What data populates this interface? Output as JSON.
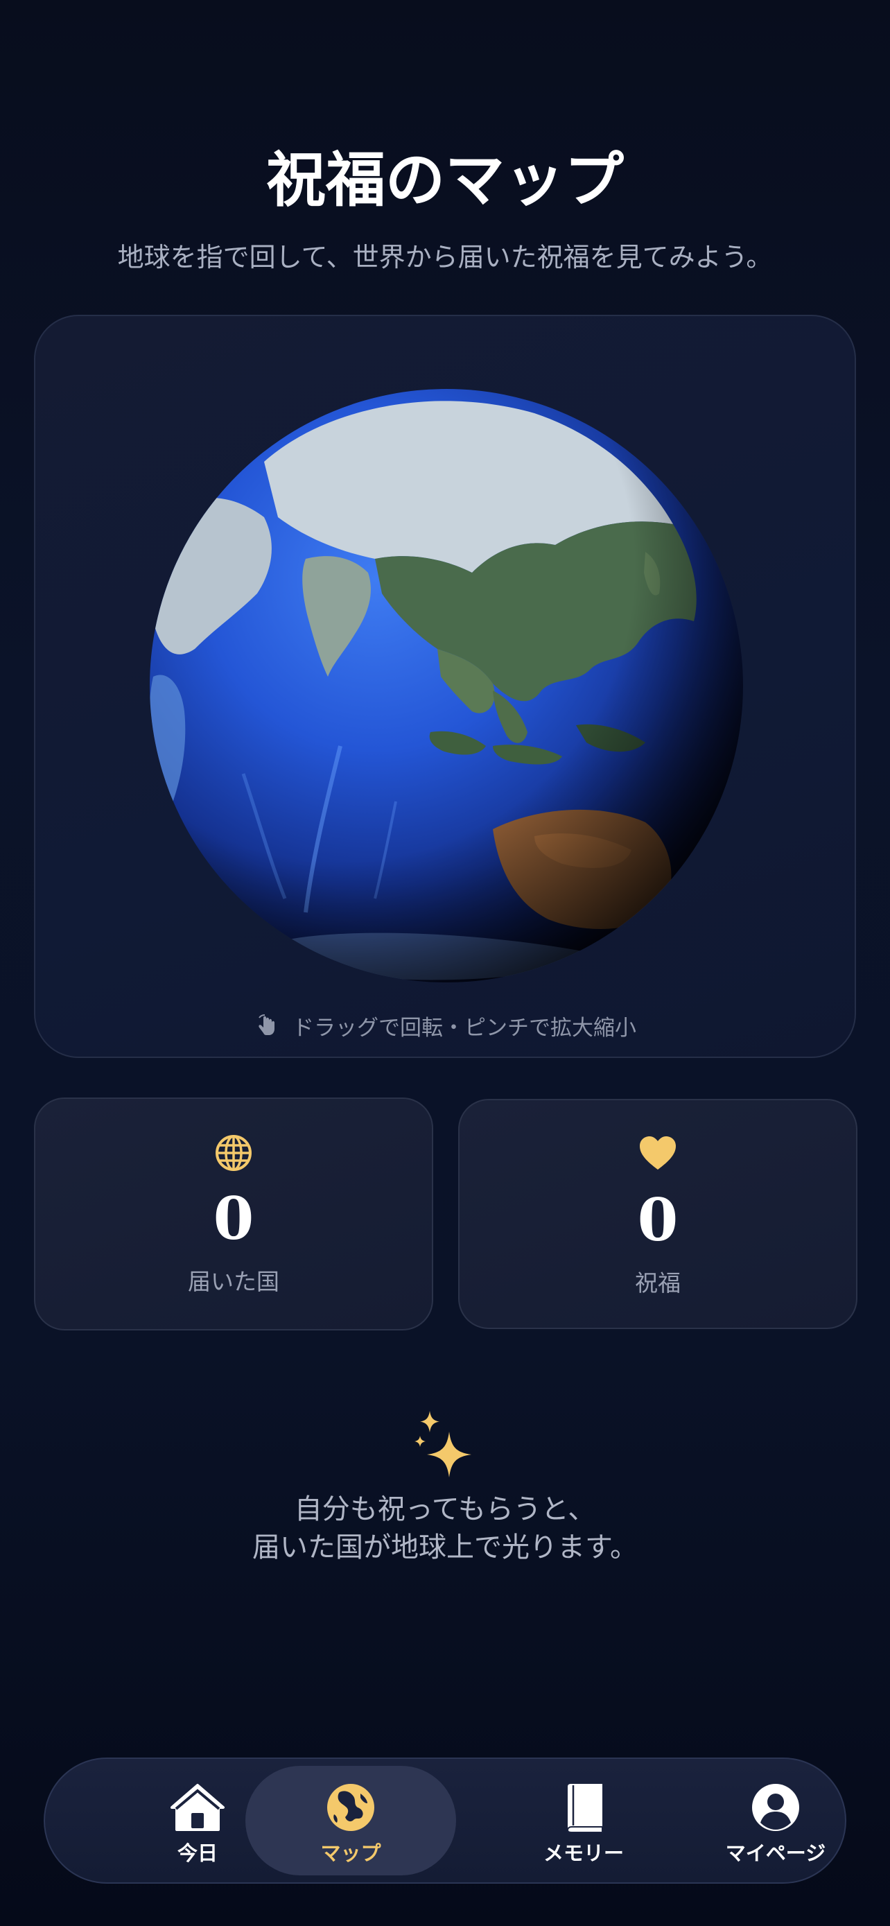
{
  "header": {
    "title": "祝福のマップ",
    "subtitle": "地球を指で回して、世界から届いた祝福を見てみよう。"
  },
  "globe": {
    "hint_icon": "hand-drag-icon",
    "hint": "ドラッグで回転・ピンチで拡大縮小"
  },
  "stats": [
    {
      "icon": "globe-icon",
      "value": "0",
      "label": "届いた国"
    },
    {
      "icon": "heart-icon",
      "value": "0",
      "label": "祝福"
    }
  ],
  "info": {
    "icon": "sparkles-icon",
    "line1": "自分も祝ってもらうと、",
    "line2": "届いた国が地球上で光ります。"
  },
  "tab_bar": {
    "active_tab": "マップ",
    "tabs": [
      {
        "icon": "home-icon",
        "label": "今日"
      },
      {
        "icon": "map-globe-icon",
        "label": "マップ"
      },
      {
        "icon": "book-icon",
        "label": "メモリー"
      },
      {
        "icon": "person-icon",
        "label": "マイページ"
      }
    ]
  },
  "colors": {
    "background": "#0a1227",
    "accent": "#f4c96b",
    "card": "#151c32",
    "text_secondary": "#9aa1b4"
  }
}
